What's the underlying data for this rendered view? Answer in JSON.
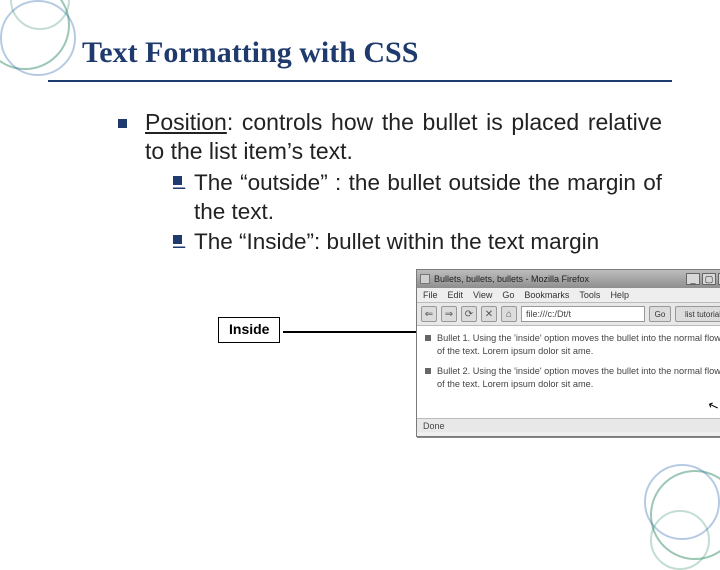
{
  "title": "Text Formatting with CSS",
  "bullet1": {
    "lead": "Position",
    "rest": ": controls how the bullet is placed relative to the list item’s text."
  },
  "sub1": " The “outside” : the bullet outside the margin of the text.",
  "sub2": "The “Inside”: bullet within the text margin",
  "inside_label": "Inside",
  "browser": {
    "title": "Bullets, bullets, bullets - Mozilla Firefox",
    "min": "_",
    "max": "▢",
    "close": "✕",
    "menu": {
      "file": "File",
      "edit": "Edit",
      "view": "View",
      "go": "Go",
      "bookmarks": "Bookmarks",
      "tools": "Tools",
      "help": "Help"
    },
    "tb": {
      "back": "⇐",
      "fwd": "⇒",
      "reload": "⟳",
      "stop": "✕",
      "home": "⌂",
      "url": "file:///c:/Dt/t",
      "go": "Go",
      "marks": "list tutorial"
    },
    "item1": "Bullet 1. Using the 'inside' option moves the bullet into the normal flow of the text. Lorem ipsum dolor sit ame.",
    "item2": "Bullet 2. Using the 'inside' option moves the bullet into the normal flow of the text. Lorem ipsum dolor sit ame.",
    "status": "Done",
    "cursor": "↖"
  }
}
